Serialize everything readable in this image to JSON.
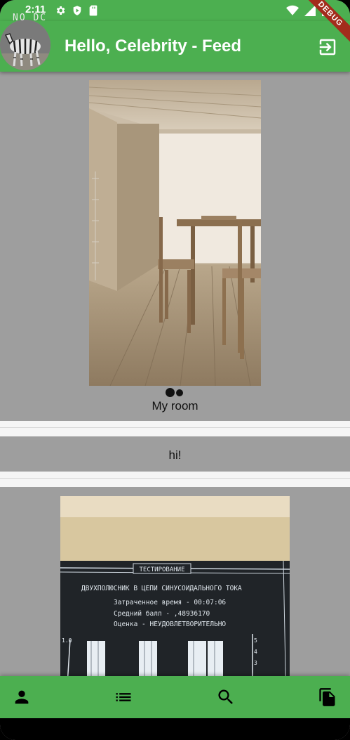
{
  "status_bar": {
    "time": "2:11",
    "icons": [
      "settings-icon",
      "shield-icon",
      "sd-card-icon",
      "wifi-icon",
      "signal-icon",
      "battery-icon"
    ]
  },
  "app_bar": {
    "title": "Hello, Celebrity - Feed",
    "avatar_label": "NO DC",
    "logout_icon": "logout-icon"
  },
  "debug_banner": "DEBUG",
  "feed": {
    "posts": [
      {
        "type": "image",
        "caption": "My room",
        "page_indicator": {
          "pages": 2,
          "active": 1
        }
      },
      {
        "type": "text",
        "text": "hi!"
      },
      {
        "type": "image",
        "screen_text": {
          "heading": "ТЕСТИРОВАНИЕ",
          "subtitle": "ДВУХПОЛЮСНИК В ЦЕПИ СИНУСОИДАЛЬНОГО ТОКА",
          "line1": "Затраченное время - 00:07:06",
          "line2": "Средний балл -  ,48936170",
          "line3": "Оценка - НЕУДОВЛЕТВОРИТЕЛЬНО",
          "axis_left": "1.0",
          "axis_right": [
            "5",
            "4",
            "3"
          ]
        }
      }
    ]
  },
  "bottom_nav": {
    "items": [
      "person-icon",
      "list-icon",
      "search-icon",
      "copy-icon"
    ]
  },
  "colors": {
    "primary": "#4caf50",
    "background": "#9e9e9e",
    "separator": "#f5f5f5"
  }
}
